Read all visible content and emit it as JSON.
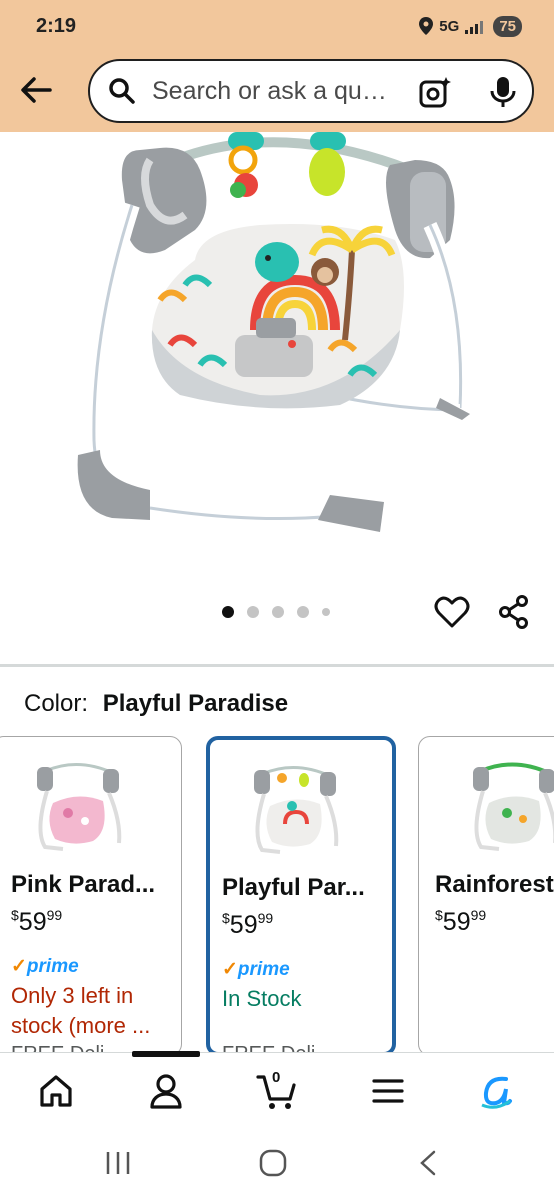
{
  "status": {
    "time": "2:19",
    "network": "5G",
    "battery": "75"
  },
  "search": {
    "placeholder": "Search or ask a qu…"
  },
  "gallery": {
    "image_count": 5,
    "active_index": 0
  },
  "color": {
    "label": "Color:",
    "value": "Playful Paradise"
  },
  "swatches": [
    {
      "name": "Pink Parad...",
      "price_dollar": "$",
      "price_whole": "59",
      "price_cents": "99",
      "prime": "prime",
      "stock_line1": "Only 3 left in",
      "stock_line2": "stock (more ...",
      "clipped": "FREE Deli",
      "selected": false
    },
    {
      "name": "Playful Par...",
      "price_dollar": "$",
      "price_whole": "59",
      "price_cents": "99",
      "prime": "prime",
      "stock_line1": "In Stock",
      "stock_line2": "",
      "clipped": "FREE Deli",
      "selected": true
    },
    {
      "name": "Rainforest",
      "price_dollar": "$",
      "price_whole": "59",
      "price_cents": "99",
      "selected": false
    }
  ],
  "bottom_nav": {
    "cart_count": "0"
  },
  "colors": {
    "header": "#f2c79c",
    "selected_border": "#2162a1",
    "prime_blue": "#1a98ff",
    "stock_red": "#b12704",
    "stock_green": "#067d62"
  }
}
